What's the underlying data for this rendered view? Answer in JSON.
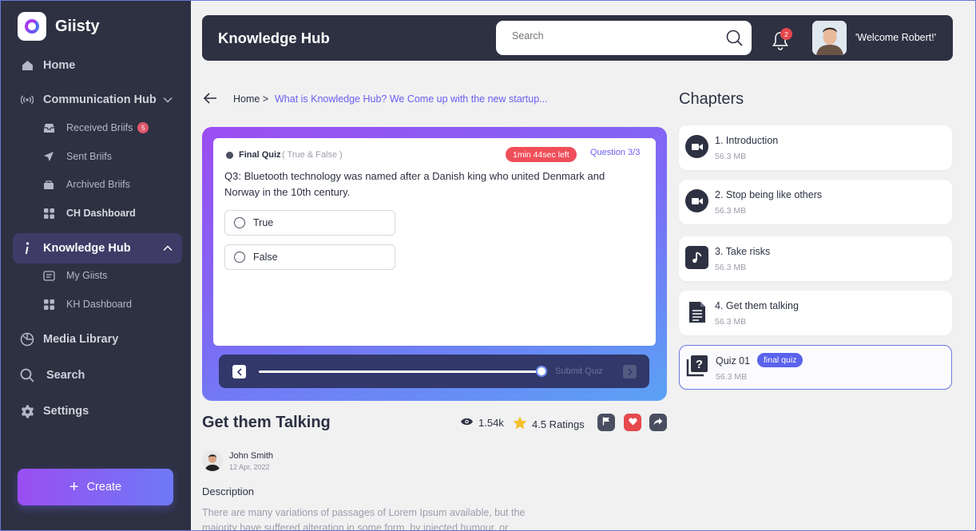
{
  "app": {
    "name": "Giisty"
  },
  "colors": {
    "sidebar": "#2d3142",
    "accent": "#6a5ef0",
    "timer": "#ef4f5a",
    "create_gradient_start": "#9a4ef2",
    "create_gradient_end": "#6e79f6"
  },
  "sidebar": {
    "items": [
      {
        "label": "Home",
        "icon": "home-icon"
      },
      {
        "label": "Communication Hub",
        "icon": "broadcast-icon"
      },
      {
        "label": "Knowledge Hub",
        "icon": "info-icon"
      },
      {
        "label": "Media Library",
        "icon": "media-icon"
      },
      {
        "label": "Search",
        "icon": "search-icon"
      },
      {
        "label": "Settings",
        "icon": "gear-icon"
      }
    ],
    "comm_sub": [
      {
        "label": "Received Briifs",
        "badge": "5",
        "icon": "inbox-icon"
      },
      {
        "label": "Sent Briifs",
        "icon": "send-icon"
      },
      {
        "label": "Archived Briifs",
        "icon": "archive-icon"
      },
      {
        "label": "CH Dashboard",
        "icon": "grid-icon"
      }
    ],
    "kh_sub": [
      {
        "label": "My Giists",
        "icon": "card-icon"
      },
      {
        "label": "KH Dashboard",
        "icon": "grid-icon"
      }
    ],
    "create_label": "Create"
  },
  "header": {
    "title": "Knowledge Hub",
    "search_placeholder": "Search",
    "notification_count": "2",
    "welcome": "'Welcome Robert!'"
  },
  "breadcrumb": {
    "home": "Home >",
    "current": "What is Knowledge Hub? We Come up with the new startup..."
  },
  "quiz": {
    "label": "Final Quiz",
    "type": "( True & False )",
    "timer": "1min 44sec left",
    "counter": "Question 3/3",
    "question": "Q3: Bluetooth technology was named after a Danish king who united Denmark and Norway in the 10th century.",
    "options": [
      "True",
      "False"
    ],
    "submit_label": "Submit Quiz",
    "progress": 1.0
  },
  "lesson": {
    "title": "Get them Talking",
    "views": "1.54k",
    "rating": "4.5 Ratings",
    "author": "John Smith",
    "date": "12 Apr, 2022",
    "description_title": "Description",
    "description": "There are many variations of passages of Lorem Ipsum available, but the majority have suffered alteration in some form, by injected humour, or"
  },
  "chapters": {
    "title": "Chapters",
    "items": [
      {
        "title": "1. Introduction",
        "size": "56.3 MB",
        "icon": "video-icon"
      },
      {
        "title": "2. Stop being like others",
        "size": "56.3 MB",
        "icon": "video-icon"
      },
      {
        "title": "3. Take risks",
        "size": "56.3 MB",
        "icon": "music-icon"
      },
      {
        "title": "4. Get them talking",
        "size": "56.3 MB",
        "icon": "document-icon"
      },
      {
        "title": "Quiz 01",
        "size": "56.3 MB",
        "icon": "quiz-icon",
        "tag": "final quiz"
      }
    ]
  }
}
